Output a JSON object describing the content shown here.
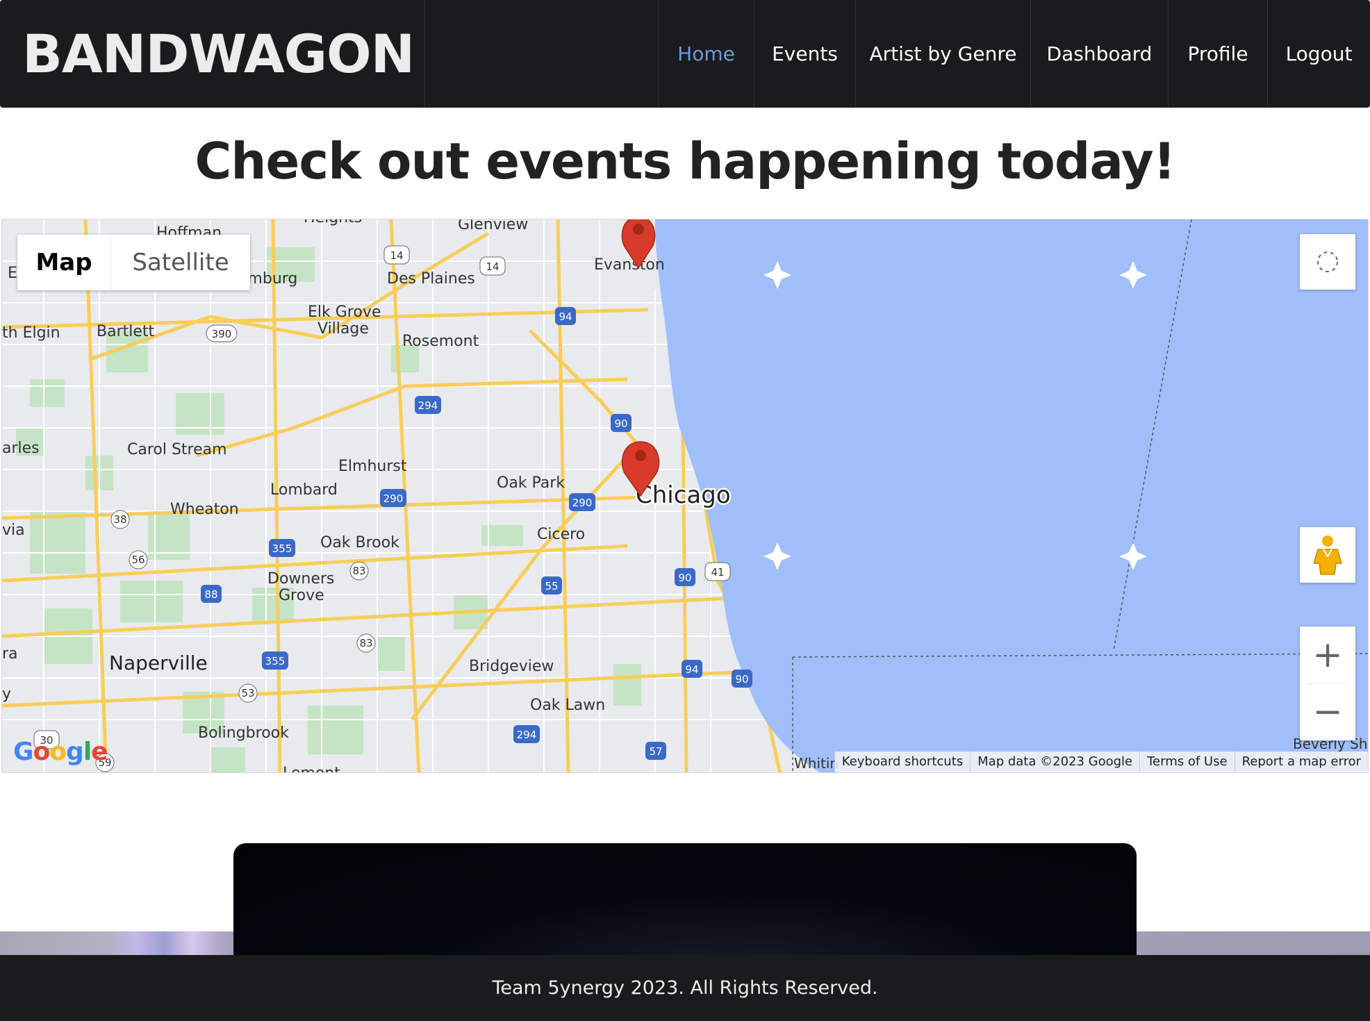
{
  "brand": "BANDWAGON",
  "nav": {
    "home": "Home",
    "events": "Events",
    "artist_by_genre": "Artist by Genre",
    "dashboard": "Dashboard",
    "profile": "Profile",
    "logout": "Logout"
  },
  "heading": "Check out events happening today!",
  "map": {
    "type_map": "Map",
    "type_satellite": "Satellite",
    "zoom_in": "+",
    "zoom_out": "−",
    "place_labels": {
      "glenview": "Glenview",
      "heights": "Heights",
      "hoffman": "Hoffman",
      "schaumburg": "Schaumburg",
      "des_plaines": "Des Plaines",
      "evanston": "Evanston",
      "elk_grove_village_1": "Elk Grove",
      "elk_grove_village_2": "Village",
      "elgin": "th Elgin",
      "bartlett": "Bartlett",
      "rosemont": "Rosemont",
      "carles": "arles",
      "carol_stream": "Carol Stream",
      "elmhurst": "Elmhurst",
      "oak_park": "Oak Park",
      "chicago": "Chicago",
      "lombard": "Lombard",
      "wheaton": "Wheaton",
      "cicero": "Cicero",
      "via": "via",
      "oak_brook": "Oak Brook",
      "downers_grove_1": "Downers",
      "downers_grove_2": "Grove",
      "ra": "ra",
      "naperville": "Naperville",
      "bridgeview": "Bridgeview",
      "oak_lawn": "Oak Lawn",
      "bolingbrook": "Bolingbrook",
      "lemont": "Lemont",
      "beverly_shores": "Beverly Sh",
      "whiting": "Whitin",
      "e": "E",
      "y": "y"
    },
    "shields": {
      "s14a": "14",
      "s14b": "14",
      "s94a": "94",
      "s390": "390",
      "s294a": "294",
      "s90a": "90",
      "s290a": "290",
      "s290b": "290",
      "s38": "38",
      "s355a": "355",
      "s56": "56",
      "s83a": "83",
      "s88": "88",
      "s55": "55",
      "s90b": "90",
      "s41": "41",
      "s83b": "83",
      "s355b": "355",
      "s94b": "94",
      "s90c": "90",
      "s53": "53",
      "s294b": "294",
      "s57": "57",
      "s30": "30",
      "s59": "59"
    },
    "attribution": {
      "keyboard": "Keyboard shortcuts",
      "map_data": "Map data ©2023 Google",
      "terms": "Terms of Use",
      "report": "Report a map error"
    },
    "google_logo": "Google",
    "colors": {
      "water": "#a0befa",
      "land": "#e8eaed",
      "park": "#c5e4c5",
      "highway": "#f8cd58",
      "marker": "#d83b2b"
    }
  },
  "footer": "Team 5ynergy 2023. All Rights Reserved."
}
